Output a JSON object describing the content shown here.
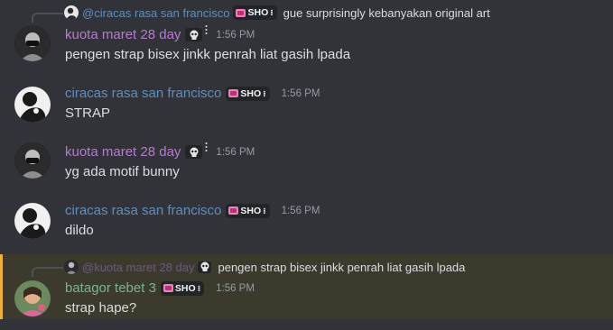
{
  "colors": {
    "background": "#313338",
    "kuota": "#b57bcf",
    "ciracas": "#5f8ec0",
    "batagor": "#7ab48f",
    "highlight_bg": "#3b3a2d",
    "highlight_bar": "#f0b232"
  },
  "messages": [
    {
      "reply": {
        "author": "@ciracas rasa san francisco",
        "tag": "SHO",
        "text": "gue surprisingly kebanyakan original art"
      },
      "author": "kuota maret 28 day",
      "time": "1:56 PM",
      "text": "pengen strap bisex jinkk penrah liat gasih lpada",
      "icon": "skull-icon"
    },
    {
      "author": "ciracas rasa san francisco",
      "tag": "SHO",
      "time": "1:56 PM",
      "text": "STRAP"
    },
    {
      "author": "kuota maret 28 day",
      "time": "1:56 PM",
      "text": "yg ada motif bunny",
      "icon": "skull-icon"
    },
    {
      "author": "ciracas rasa san francisco",
      "tag": "SHO",
      "time": "1:56 PM",
      "text": "dildo"
    },
    {
      "reply": {
        "author": "@kuota maret 28 day",
        "text": "pengen strap bisex jinkk penrah liat gasih lpada"
      },
      "author": "batagor tebet 3",
      "tag": "SHO",
      "time": "1:56 PM",
      "text": "strap hape?"
    }
  ]
}
